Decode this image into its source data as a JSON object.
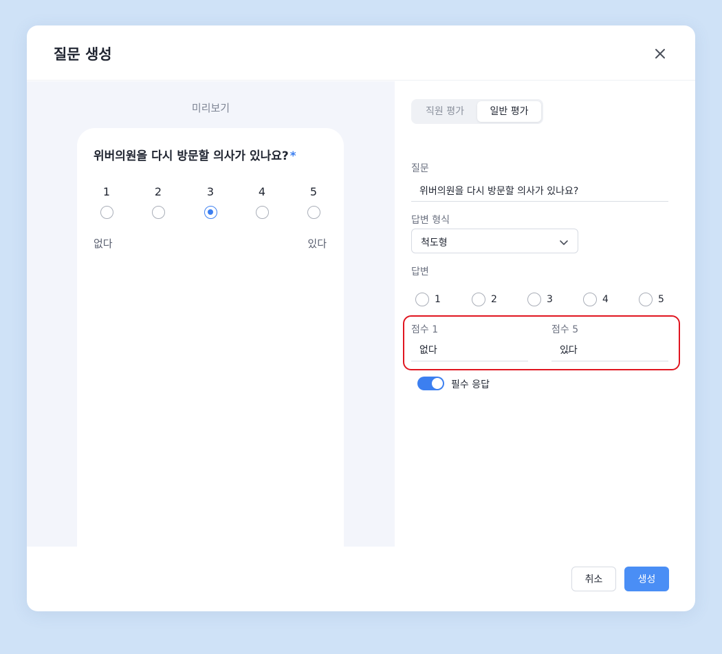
{
  "modal": {
    "title": "질문 생성"
  },
  "preview": {
    "label": "미리보기",
    "question": "위버의원을 다시 방문할 의사가 있나요?",
    "required_mark": "*",
    "scale": [
      "1",
      "2",
      "3",
      "4",
      "5"
    ],
    "selected": "3",
    "min_label": "없다",
    "max_label": "있다"
  },
  "form": {
    "tabs": [
      {
        "label": "직원 평가",
        "active": false
      },
      {
        "label": "일반 평가",
        "active": true
      }
    ],
    "question_label": "질문",
    "question_value": "위버의원을 다시 방문할 의사가 있나요?",
    "answer_type_label": "답변 형식",
    "answer_type_value": "척도형",
    "answers_label": "답변",
    "answers": [
      "1",
      "2",
      "3",
      "4",
      "5"
    ],
    "score_min_label": "점수 1",
    "score_min_value": "없다",
    "score_max_label": "점수 5",
    "score_max_value": "있다",
    "range_separator": "~",
    "required_toggle_label": "필수 응답",
    "required_toggle_on": true
  },
  "footer": {
    "cancel_label": "취소",
    "create_label": "생성"
  },
  "colors": {
    "accent": "#3c7ff0",
    "highlight_border": "#e0141f",
    "background": "#cfe2f7"
  },
  "icons": {
    "close": "close-icon",
    "chevron": "chevron-down-icon"
  }
}
